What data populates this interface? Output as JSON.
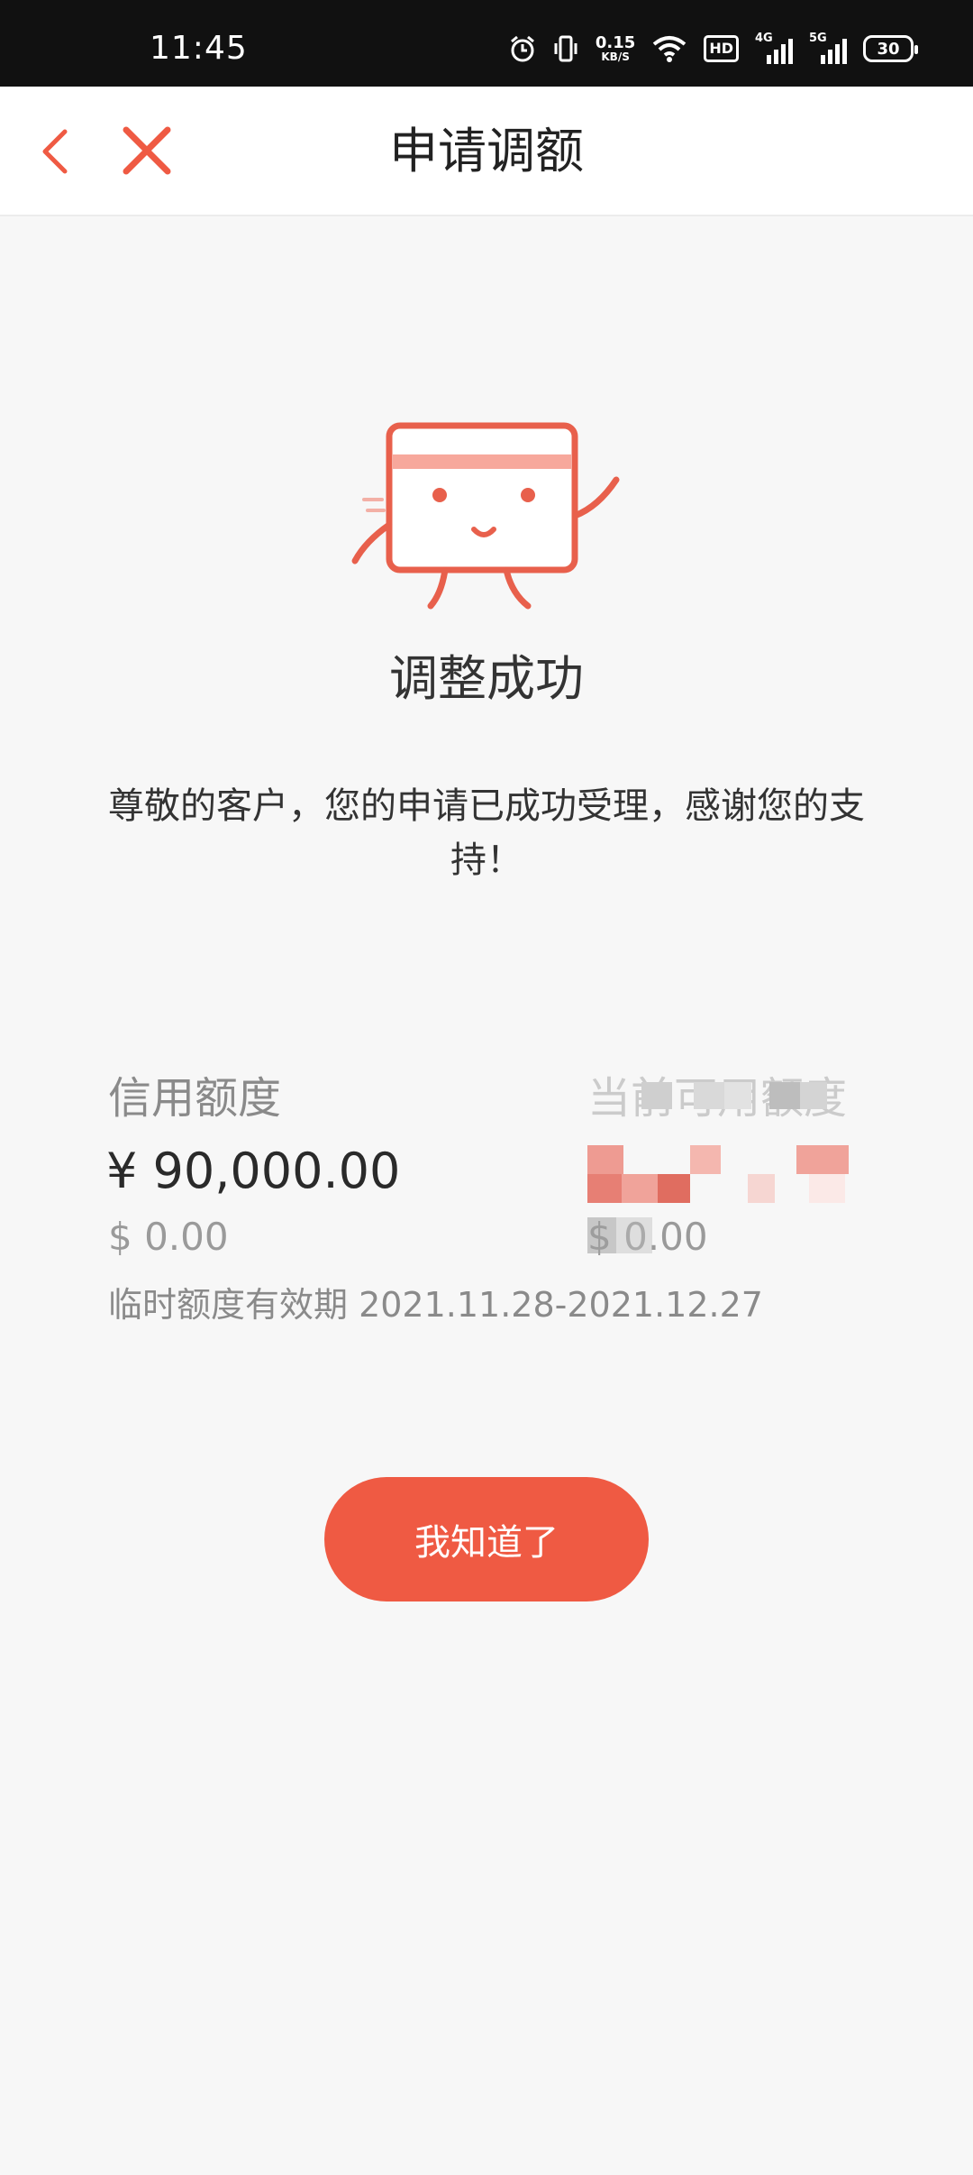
{
  "status_bar": {
    "time": "11:45",
    "net_speed_value": "0.15",
    "net_speed_unit": "KB/S",
    "hd_label": "HD",
    "sim1_type": "4G",
    "sim2_type": "5G",
    "battery_level": "30",
    "icons": [
      "alarm-icon",
      "vibrate-icon",
      "wifi-icon",
      "hd-icon",
      "signal-4g-icon",
      "signal-5g-icon",
      "battery-icon"
    ]
  },
  "nav": {
    "title": "申请调额",
    "back_icon": "chevron-left-icon",
    "close_icon": "close-icon"
  },
  "result": {
    "title": "调整成功",
    "message": "尊敬的客户，您的申请已成功受理，感谢您的支持！"
  },
  "credit": {
    "label": "信用额度",
    "amount": "¥ 90,000.00",
    "usd": "$ 0.00",
    "temp_period": "临时额度有效期 2021.11.28-2021.12.27"
  },
  "available": {
    "label": "当前可用额度",
    "usd": "$ 0.00"
  },
  "button": {
    "ok_label": "我知道了"
  },
  "colors": {
    "accent": "#ef5a43",
    "accent_light": "#f7a89c",
    "background": "#f7f7f7",
    "status_bar": "#111111"
  }
}
